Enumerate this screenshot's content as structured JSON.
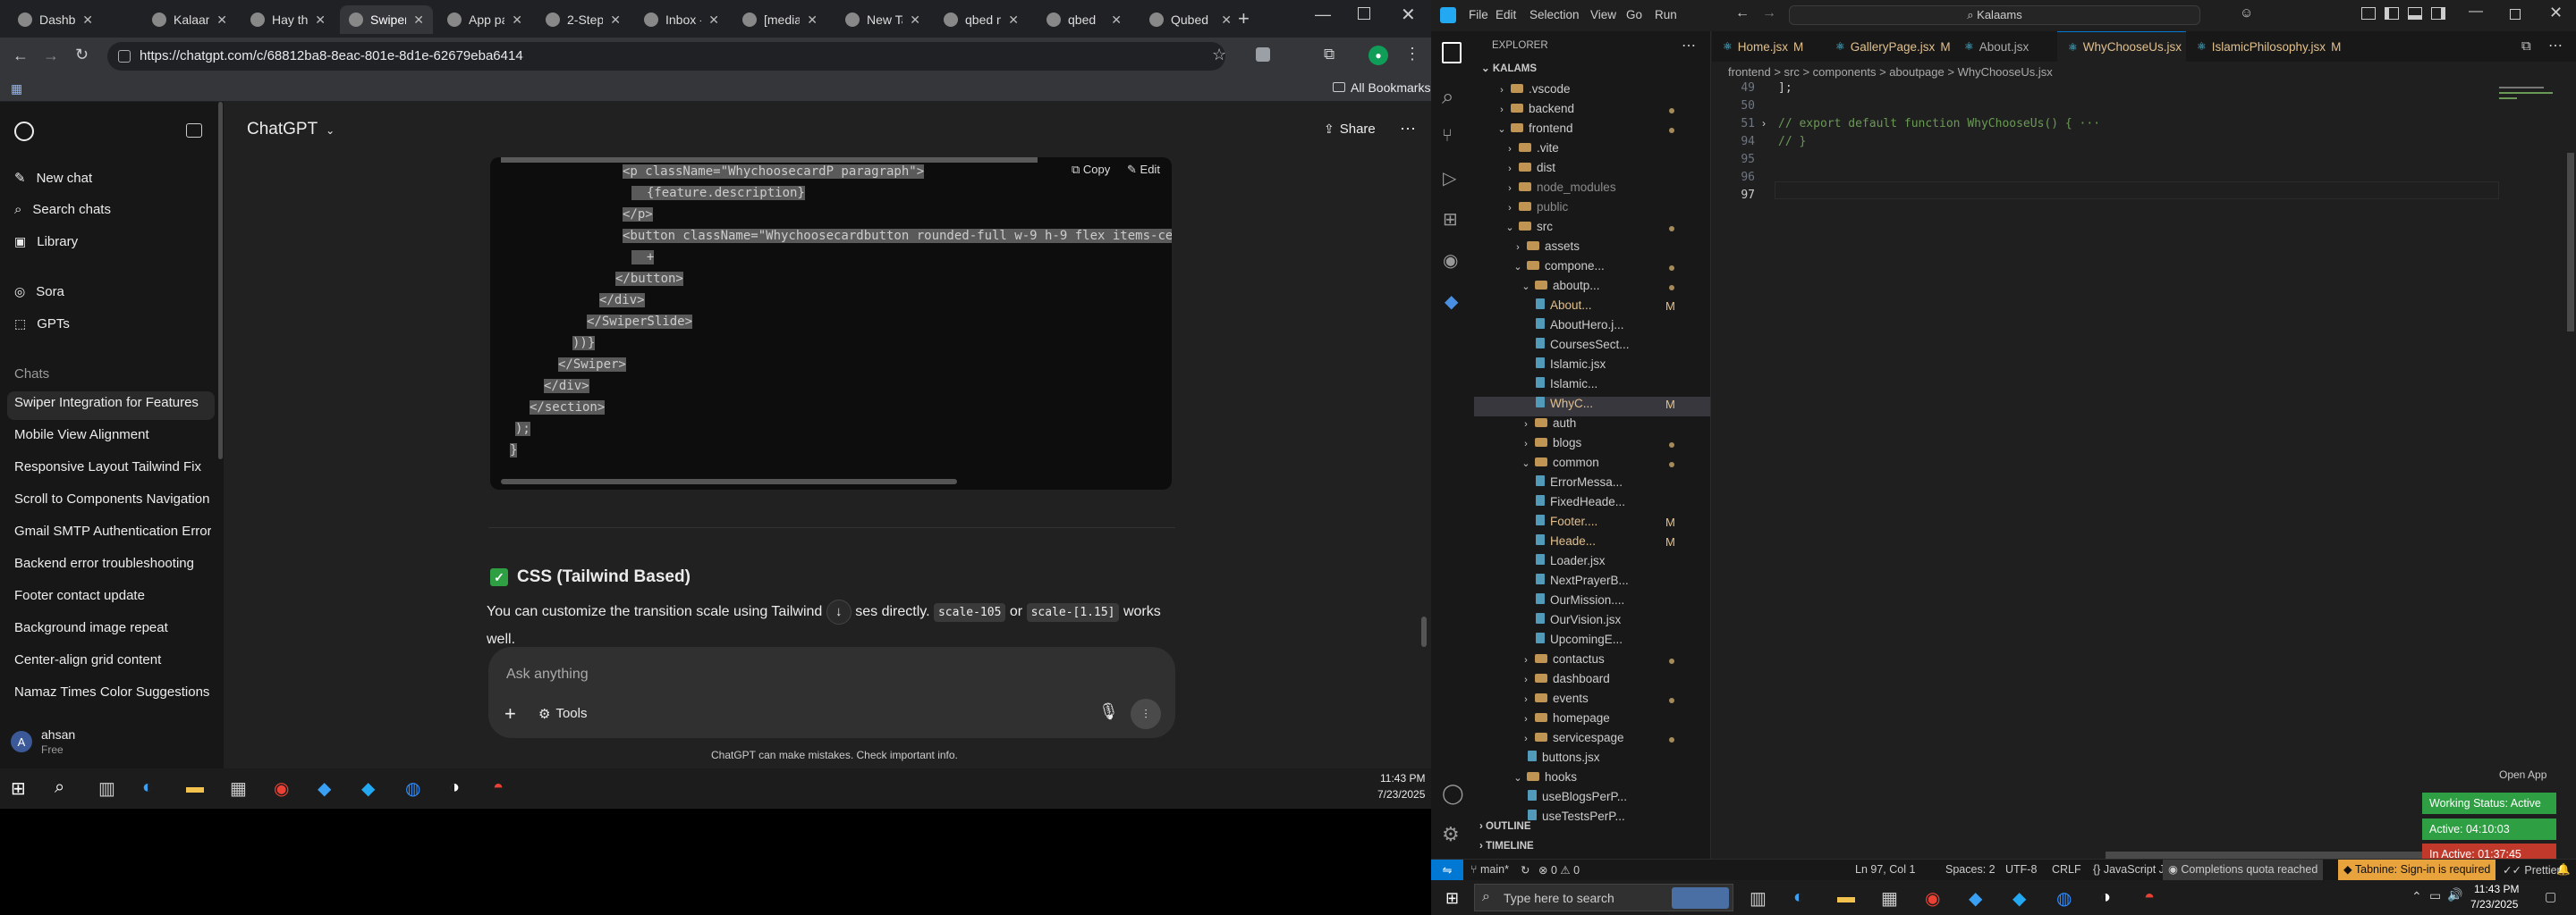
{
  "browser": {
    "tabs": [
      "Dashbo",
      "Kalaam",
      "Hay the",
      "Swiper",
      "App pa",
      "2-Step",
      "Inbox -",
      "[media",
      "New Ta",
      "qbed n",
      "qbed",
      "Qubed"
    ],
    "url": "https://chatgpt.com/c/68812ba8-8eac-801e-8d1e-62679eba6414",
    "all_bookmarks": "All Bookmarks"
  },
  "chatgpt": {
    "title": "ChatGPT",
    "share": "Share",
    "nav": [
      "New chat",
      "Search chats",
      "Library",
      "Sora",
      "GPTs"
    ],
    "chats_header": "Chats",
    "chats": [
      "Swiper Integration for Features",
      "Mobile View Alignment",
      "Responsive Layout Tailwind Fix",
      "Scroll to Components Navigation",
      "Gmail SMTP Authentication Error",
      "Backend error troubleshooting",
      "Footer contact update",
      "Background image repeat",
      "Center-align grid content",
      "Namaz Times Color Suggestions"
    ],
    "user_name": "ahsan",
    "user_plan": "Free",
    "user_initial": "A",
    "copy": "Copy",
    "edit": "Edit",
    "code_lines": [
      "<p className=\"WhychoosecardP paragraph\">",
      "  {feature.description}",
      "</p>",
      "<button className=\"Whychoosecardbutton rounded-full w-9 h-9 flex items-center just",
      "  +",
      "</button>",
      "</div>",
      "</SwiperSlide>",
      "))}",
      "</Swiper>",
      "</div>",
      "</section>",
      ");",
      "}"
    ],
    "heading": "CSS (Tailwind Based)",
    "para_pre": "You can customize the transition scale using Tailwind",
    "para_mid": "ses directly.",
    "code1": "scale-105",
    "or": "or",
    "code2": "scale-[1.15]",
    "works": "works",
    "well": "well.",
    "placeholder": "Ask anything",
    "tools": "Tools",
    "disclaimer": "ChatGPT can make mistakes. Check important info."
  },
  "taskbar_left": {
    "time": "11:43 PM",
    "date": "7/23/2025"
  },
  "vscode": {
    "menu": [
      "File",
      "Edit",
      "Selection",
      "View",
      "Go",
      "Run"
    ],
    "search": "Kalaams",
    "explorer_title": "EXPLORER",
    "root": "KALAMS",
    "tabs": [
      "Home.jsx",
      "GalleryPage.jsx",
      "About.jsx",
      "WhyChooseUs.jsx",
      "IslamicPhilosophy.jsx"
    ],
    "tab_mod": "M",
    "breadcrumb": "frontend > src > components > aboutpage > WhyChooseUs.jsx",
    "tree": [
      ".vscode",
      "backend",
      "frontend",
      ".vite",
      "dist",
      "node_modules",
      "public",
      "src",
      "assets",
      "compone...",
      "aboutp...",
      "About...",
      "AboutHero.j...",
      "CoursesSect...",
      "Islamic.jsx",
      "Islamic...",
      "WhyC...",
      "auth",
      "blogs",
      "common",
      "ErrorMessa...",
      "FixedHeade...",
      "Footer....",
      "Heade...",
      "Loader.jsx",
      "NextPrayerB...",
      "OurMission....",
      "OurVision.jsx",
      "UpcomingE...",
      "contactus",
      "dashboard",
      "events",
      "homepage",
      "servicespage",
      "buttons.jsx",
      "hooks",
      "useBlogsPerP...",
      "useTestsPerP..."
    ],
    "outline": "OUTLINE",
    "timeline": "TIMELINE",
    "line_numbers": [
      "49",
      "50",
      "51",
      "94",
      "95",
      "96",
      "97"
    ],
    "code": [
      "];",
      "",
      "// export default function WhyChooseUs() { ···",
      "// }",
      "",
      "",
      ""
    ],
    "open_app": "Open App",
    "status": {
      "branch": "main*",
      "errors": "0",
      "warnings": "0",
      "ln": "Ln 97, Col 1",
      "spaces": "Spaces: 2",
      "enc": "UTF-8",
      "eol": "CRLF",
      "lang": "JavaScript JSX",
      "quota": "Completions quota reached",
      "tabnine": "Tabnine: Sign-in is required",
      "prettier": "Prettier"
    },
    "working_status": "Working Status: Active",
    "active": "Active: 04:10:03",
    "inactive": "In Active: 01:37:45"
  },
  "taskbar_right": {
    "search": "Type here to search",
    "time": "11:43 PM",
    "date": "7/23/2025"
  }
}
